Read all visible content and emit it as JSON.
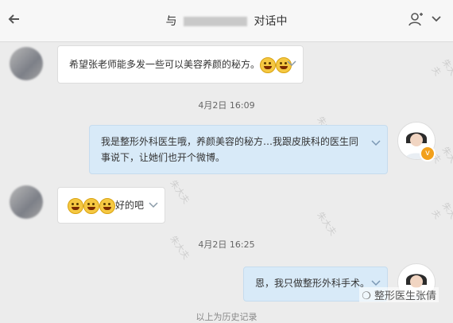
{
  "header": {
    "title_prefix": "与",
    "title_suffix": "对话中"
  },
  "messages": [
    {
      "side": "in",
      "text": "希望张老师能多发一些可以美容养颜的秘方。"
    },
    {
      "time": "4月2日 16:09"
    },
    {
      "side": "out",
      "text": "我是整形外科医生哦，养颜美容的秘方…我跟皮肤科的医生同事说下，让她们也开个微博。"
    },
    {
      "side": "in",
      "text": "好的吧"
    },
    {
      "time": "4月2日 16:25"
    },
    {
      "side": "out",
      "text": "恩，我只做整形外科手术。"
    }
  ],
  "footer": {
    "history_text": "以上为历史记录",
    "watermark": "整形医生张倩"
  },
  "colors": {
    "header_bg": "#f7f7f7",
    "chat_bg": "#ececec",
    "incoming_bg": "#ffffff",
    "outgoing_bg": "#d8eaf8",
    "badge": "#f2a01b"
  }
}
